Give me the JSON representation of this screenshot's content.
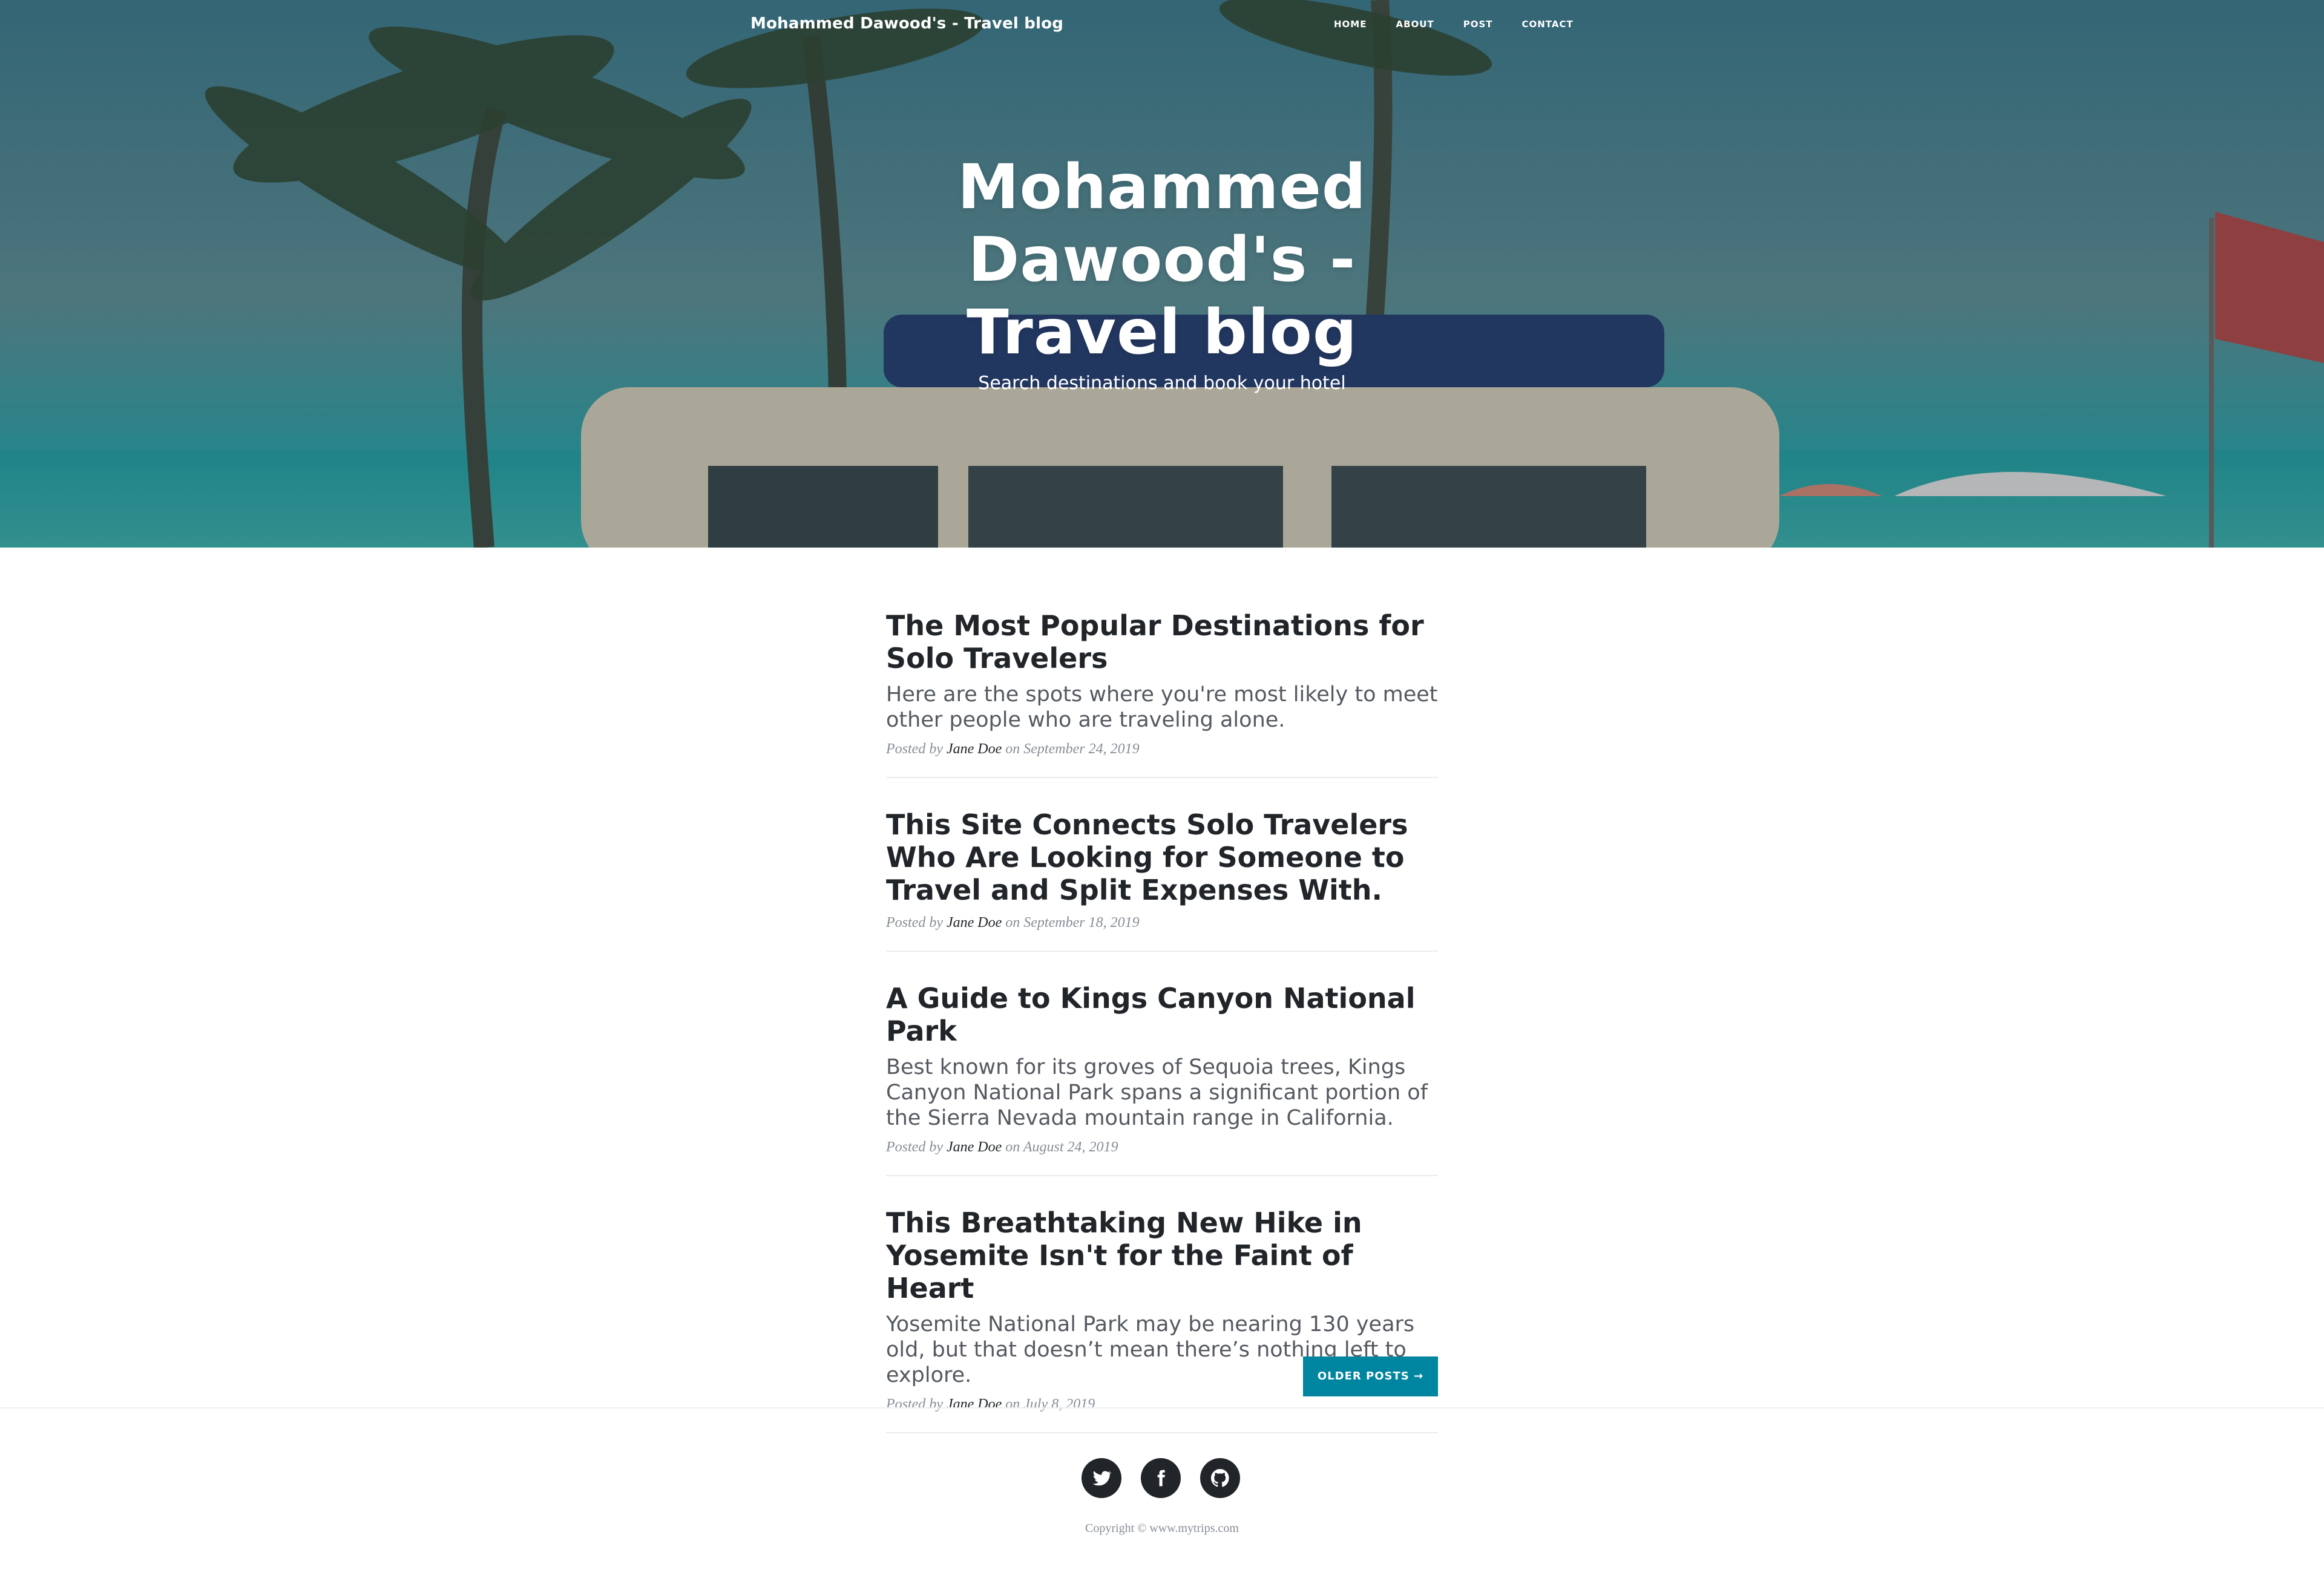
{
  "navbar": {
    "brand": "Mohammed Dawood's - Travel blog",
    "links": [
      "HOME",
      "ABOUT",
      "POST",
      "CONTACT"
    ]
  },
  "hero": {
    "title": "Mohammed Dawood's - Travel blog",
    "subtitle": "Search destinations and book your hotel"
  },
  "posts": [
    {
      "title": "The Most Popular Destinations for Solo Travelers",
      "subtitle": "Here are the spots where you're most likely to meet other people who are traveling alone.",
      "meta_prefix": "Posted by",
      "author": "Jane Doe",
      "date_text": "on September 24, 2019"
    },
    {
      "title": "This Site Connects Solo Travelers Who Are Looking for Someone to Travel and Split Expenses With.",
      "subtitle": "",
      "meta_prefix": "Posted by",
      "author": "Jane Doe",
      "date_text": "on September 18, 2019"
    },
    {
      "title": "A Guide to Kings Canyon National Park",
      "subtitle": "Best known for its groves of Sequoia trees, Kings Canyon National Park spans a significant portion of the Sierra Nevada mountain range in California.",
      "meta_prefix": "Posted by",
      "author": "Jane Doe",
      "date_text": "on August 24, 2019"
    },
    {
      "title": "This Breathtaking New Hike in Yosemite Isn't for the Faint of Heart",
      "subtitle": "Yosemite National Park may be nearing 130 years old, but that doesn’t mean there’s nothing left to explore.",
      "meta_prefix": "Posted by",
      "author": "Jane Doe",
      "date_text": "on July 8, 2019"
    }
  ],
  "pager": {
    "older_label": "OLDER POSTS →"
  },
  "footer": {
    "social_icons": [
      "twitter-icon",
      "facebook-icon",
      "github-icon"
    ],
    "copyright": "Copyright © www.mytrips.com"
  },
  "colors": {
    "accent": "#0085a1",
    "text_dark": "#212529",
    "text_muted": "#868e96"
  }
}
